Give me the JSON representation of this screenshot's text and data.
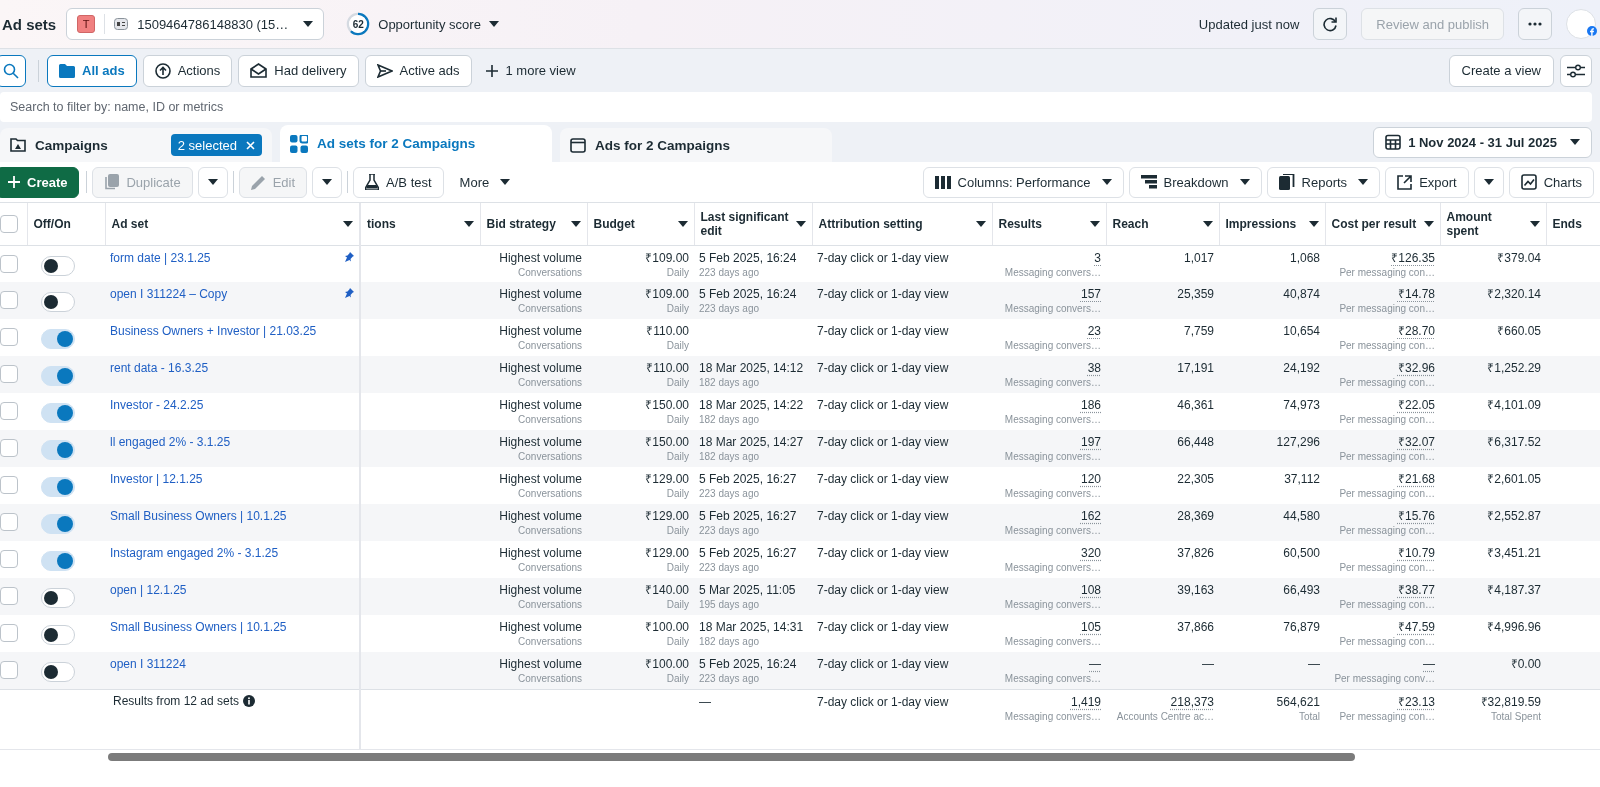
{
  "header": {
    "title": "Ad sets",
    "account": {
      "badge": "T",
      "name": "1509464786148830 (15…"
    },
    "opportunity": {
      "score": "62",
      "level": 0.62,
      "label": "Opportunity score"
    },
    "status": "Updated just now",
    "publish": {
      "label": "Review and publish",
      "disabled": true
    }
  },
  "views": {
    "items": [
      {
        "kind": "folder",
        "label": "All ads",
        "selected": true
      },
      {
        "kind": "actions",
        "label": "Actions",
        "selected": false
      },
      {
        "kind": "delivery",
        "label": "Had delivery",
        "selected": false
      },
      {
        "kind": "active",
        "label": "Active ads",
        "selected": false
      }
    ],
    "more": "1 more view",
    "create": "Create a view"
  },
  "search": {
    "placeholder": "Search to filter by: name, ID or metrics"
  },
  "tabs": [
    {
      "kind": "campaigns",
      "label": "Campaigns",
      "selected": false,
      "badge": "2 selected"
    },
    {
      "kind": "adsets",
      "label": "Ad sets for 2 Campaigns",
      "selected": true
    },
    {
      "kind": "ads",
      "label": "Ads for 2 Campaigns",
      "selected": false
    }
  ],
  "date_range": "1 Nov 2024 - 31 Jul 2025",
  "toolbar": {
    "left": [
      {
        "kind": "create",
        "label": "Create",
        "disabled": false
      },
      {
        "kind": "duplicate",
        "label": "Duplicate",
        "disabled": true
      },
      {
        "kind": "caret",
        "disabled": false
      },
      {
        "kind": "edit",
        "label": "Edit",
        "disabled": true
      },
      {
        "kind": "caret",
        "disabled": false
      },
      {
        "kind": "abtest",
        "label": "A/B test",
        "disabled": false
      },
      {
        "kind": "more",
        "label": "More",
        "disabled": false
      }
    ],
    "right": [
      {
        "kind": "columns",
        "label": "Columns: Performance"
      },
      {
        "kind": "breakdown",
        "label": "Breakdown"
      },
      {
        "kind": "reports",
        "label": "Reports"
      },
      {
        "kind": "export",
        "label": "Export"
      },
      {
        "kind": "caret"
      },
      {
        "kind": "charts",
        "label": "Charts"
      }
    ]
  },
  "table": {
    "all_selected": false,
    "columns": [
      {
        "label": "Off/On",
        "menu": false
      },
      {
        "label": "Ad set",
        "menu": true
      },
      {
        "label": "tions",
        "menu": true
      },
      {
        "label": "Bid strategy",
        "menu": true
      },
      {
        "label": "Budget",
        "menu": true
      },
      {
        "label": "Last significant edit",
        "menu": true
      },
      {
        "label": "Attribution setting",
        "menu": true
      },
      {
        "label": "Results",
        "menu": true
      },
      {
        "label": "Reach",
        "menu": true
      },
      {
        "label": "Impressions",
        "menu": true
      },
      {
        "label": "Cost per result",
        "menu": true
      },
      {
        "label": "Amount spent",
        "menu": true
      },
      {
        "label": "Ends",
        "menu": false
      }
    ],
    "rows": [
      {
        "selected": false,
        "on": false,
        "name": "form date | 23.1.25",
        "pinned": true,
        "bid_strategy": "Highest volume",
        "bid_note": "Conversations",
        "budget": "₹109.00",
        "budget_note": "Daily",
        "last_edit": "5 Feb 2025, 16:24",
        "last_edit_ago": "223 days ago",
        "attribution": "7-day click or 1-day view",
        "results": "3",
        "results_note": "Messaging convers…",
        "reach": "1,017",
        "impressions": "1,068",
        "cost": "₹126.35",
        "cost_note": "Per messaging con…",
        "amount": "₹379.04"
      },
      {
        "selected": false,
        "on": false,
        "name": "open I 311224 – Copy",
        "pinned": true,
        "bid_strategy": "Highest volume",
        "bid_note": "Conversations",
        "budget": "₹109.00",
        "budget_note": "Daily",
        "last_edit": "5 Feb 2025, 16:24",
        "last_edit_ago": "223 days ago",
        "attribution": "7-day click or 1-day view",
        "results": "157",
        "results_note": "Messaging convers…",
        "reach": "25,359",
        "impressions": "40,874",
        "cost": "₹14.78",
        "cost_note": "Per messaging con…",
        "amount": "₹2,320.14"
      },
      {
        "selected": false,
        "on": true,
        "name": "Business Owners + Investor | 21.03.25",
        "pinned": false,
        "bid_strategy": "Highest volume",
        "bid_note": "Conversations",
        "budget": "₹110.00",
        "budget_note": "Daily",
        "attribution": "7-day click or 1-day view",
        "results": "23",
        "results_note": "Messaging convers…",
        "reach": "7,759",
        "impressions": "10,654",
        "cost": "₹28.70",
        "cost_note": "Per messaging con…",
        "amount": "₹660.05"
      },
      {
        "selected": false,
        "on": true,
        "name": "rent data - 16.3.25",
        "pinned": false,
        "bid_strategy": "Highest volume",
        "bid_note": "Conversations",
        "budget": "₹110.00",
        "budget_note": "Daily",
        "last_edit": "18 Mar 2025, 14:12",
        "last_edit_ago": "182 days ago",
        "attribution": "7-day click or 1-day view",
        "results": "38",
        "results_note": "Messaging convers…",
        "reach": "17,191",
        "impressions": "24,192",
        "cost": "₹32.96",
        "cost_note": "Per messaging con…",
        "amount": "₹1,252.29"
      },
      {
        "selected": false,
        "on": true,
        "name": "Investor - 24.2.25",
        "pinned": false,
        "bid_strategy": "Highest volume",
        "bid_note": "Conversations",
        "budget": "₹150.00",
        "budget_note": "Daily",
        "last_edit": "18 Mar 2025, 14:22",
        "last_edit_ago": "182 days ago",
        "attribution": "7-day click or 1-day view",
        "results": "186",
        "results_note": "Messaging convers…",
        "reach": "46,361",
        "impressions": "74,973",
        "cost": "₹22.05",
        "cost_note": "Per messaging con…",
        "amount": "₹4,101.09"
      },
      {
        "selected": false,
        "on": true,
        "name": "ll engaged 2% - 3.1.25",
        "pinned": false,
        "bid_strategy": "Highest volume",
        "bid_note": "Conversations",
        "budget": "₹150.00",
        "budget_note": "Daily",
        "last_edit": "18 Mar 2025, 14:27",
        "last_edit_ago": "182 days ago",
        "attribution": "7-day click or 1-day view",
        "results": "197",
        "results_note": "Messaging convers…",
        "reach": "66,448",
        "impressions": "127,296",
        "cost": "₹32.07",
        "cost_note": "Per messaging con…",
        "amount": "₹6,317.52"
      },
      {
        "selected": false,
        "on": true,
        "name": "Investor | 12.1.25",
        "pinned": false,
        "bid_strategy": "Highest volume",
        "bid_note": "Conversations",
        "budget": "₹129.00",
        "budget_note": "Daily",
        "last_edit": "5 Feb 2025, 16:27",
        "last_edit_ago": "223 days ago",
        "attribution": "7-day click or 1-day view",
        "results": "120",
        "results_note": "Messaging convers…",
        "reach": "22,305",
        "impressions": "37,112",
        "cost": "₹21.68",
        "cost_note": "Per messaging con…",
        "amount": "₹2,601.05"
      },
      {
        "selected": false,
        "on": true,
        "name": "Small Business Owners | 10.1.25",
        "pinned": false,
        "bid_strategy": "Highest volume",
        "bid_note": "Conversations",
        "budget": "₹129.00",
        "budget_note": "Daily",
        "last_edit": "5 Feb 2025, 16:27",
        "last_edit_ago": "223 days ago",
        "attribution": "7-day click or 1-day view",
        "results": "162",
        "results_note": "Messaging convers…",
        "reach": "28,369",
        "impressions": "44,580",
        "cost": "₹15.76",
        "cost_note": "Per messaging con…",
        "amount": "₹2,552.87"
      },
      {
        "selected": false,
        "on": true,
        "name": "Instagram engaged 2% - 3.1.25",
        "pinned": false,
        "bid_strategy": "Highest volume",
        "bid_note": "Conversations",
        "budget": "₹129.00",
        "budget_note": "Daily",
        "last_edit": "5 Feb 2025, 16:27",
        "last_edit_ago": "223 days ago",
        "attribution": "7-day click or 1-day view",
        "results": "320",
        "results_note": "Messaging convers…",
        "reach": "37,826",
        "impressions": "60,500",
        "cost": "₹10.79",
        "cost_note": "Per messaging con…",
        "amount": "₹3,451.21"
      },
      {
        "selected": false,
        "on": false,
        "name": "open | 12.1.25",
        "pinned": false,
        "bid_strategy": "Highest volume",
        "bid_note": "Conversations",
        "budget": "₹140.00",
        "budget_note": "Daily",
        "last_edit": "5 Mar 2025, 11:05",
        "last_edit_ago": "195 days ago",
        "attribution": "7-day click or 1-day view",
        "results": "108",
        "results_note": "Messaging convers…",
        "reach": "39,163",
        "impressions": "66,493",
        "cost": "₹38.77",
        "cost_note": "Per messaging con…",
        "amount": "₹4,187.37"
      },
      {
        "selected": false,
        "on": false,
        "name": "Small Business Owners | 10.1.25",
        "pinned": false,
        "bid_strategy": "Highest volume",
        "bid_note": "Conversations",
        "budget": "₹100.00",
        "budget_note": "Daily",
        "last_edit": "18 Mar 2025, 14:31",
        "last_edit_ago": "182 days ago",
        "attribution": "7-day click or 1-day view",
        "results": "105",
        "results_note": "Messaging convers…",
        "reach": "37,866",
        "impressions": "76,879",
        "cost": "₹47.59",
        "cost_note": "Per messaging con…",
        "amount": "₹4,996.96"
      },
      {
        "selected": false,
        "on": false,
        "name": "open I 311224",
        "pinned": false,
        "bid_strategy": "Highest volume",
        "bid_note": "Conversations",
        "budget": "₹100.00",
        "budget_note": "Daily",
        "last_edit": "5 Feb 2025, 16:24",
        "last_edit_ago": "223 days ago",
        "attribution": "7-day click or 1-day view",
        "results": "—",
        "results_note": "Messaging convers…",
        "reach": "—",
        "impressions": "—",
        "cost": "—",
        "cost_note": "Per messaging conv…",
        "amount": "₹0.00"
      }
    ],
    "summary": {
      "label": "Results from 12 ad sets",
      "last_edit": "—",
      "attribution": "7-day click or 1-day view",
      "results": "1,419",
      "results_note": "Messaging convers…",
      "reach": "218,373",
      "reach_note": "Accounts Centre ac…",
      "impressions": "564,621",
      "impressions_note": "Total",
      "cost": "₹23.13",
      "cost_note": "Per messaging con…",
      "amount": "₹32,819.59",
      "amount_note": "Total Spent"
    }
  }
}
